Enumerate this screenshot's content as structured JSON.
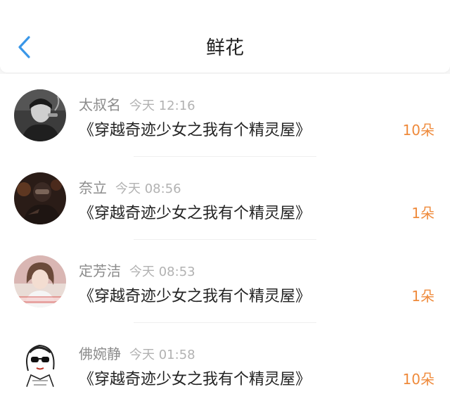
{
  "header": {
    "title": "鲜花",
    "back_icon": "chevron-left-icon",
    "accent": "#3a97e8"
  },
  "colors": {
    "quantity": "#ef8a3b",
    "name": "#8b8b8b",
    "time": "#b2b2b2"
  },
  "items": [
    {
      "name": "太叔名",
      "time": "今天 12:16",
      "book": "《穿越奇迹少女之我有个精灵屋》",
      "quantity": "10朵",
      "avatar": "avatar-man-smoking"
    },
    {
      "name": "奈立",
      "time": "今天 08:56",
      "book": "《穿越奇迹少女之我有个精灵屋》",
      "quantity": "1朵",
      "avatar": "avatar-masked-figure"
    },
    {
      "name": "定芳洁",
      "time": "今天 08:53",
      "book": "《穿越奇迹少女之我有个精灵屋》",
      "quantity": "1朵",
      "avatar": "avatar-girl-photo"
    },
    {
      "name": "佛婉静",
      "time": "今天 01:58",
      "book": "《穿越奇迹少女之我有个精灵屋》",
      "quantity": "10朵",
      "avatar": "avatar-sketch-girl"
    }
  ]
}
